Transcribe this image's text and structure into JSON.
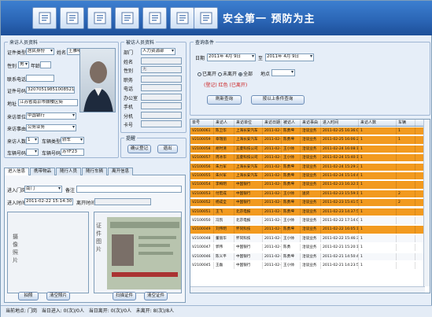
{
  "app_title": "安全第一  预防为主",
  "toolbar_icons": [
    "document-edit-icon",
    "id-card-icon",
    "person-card-icon",
    "form-edit-icon",
    "refresh-icon",
    "print-icon",
    "exit-icon"
  ],
  "colors": {
    "header": "#2a64b4",
    "highlight_row": "#f29a1f"
  },
  "visitor_panel": {
    "legend": "来访人员资料",
    "id_type_label": "证件类型",
    "id_type": "居民身份",
    "name_label": "姓名",
    "name": "王雅明",
    "gender_label": "性别",
    "gender": "男",
    "age_label": "年龄",
    "phone_label": "联系电话",
    "id_no_label": "证件号码",
    "id_no": "320705198510085215",
    "address_label": "地址",
    "address": "江苏省南京市鼓楼区街",
    "unit_label": "来访单位",
    "unit": "中国银行",
    "reason_label": "来访事由",
    "reason": "公务业务",
    "count_label": "来访人数",
    "count": "1",
    "car_type_label": "车辆类型",
    "car_type": "轿车",
    "plate_label": "车辆号码",
    "plate": "苏YF23"
  },
  "host_panel": {
    "legend": "被访人员资料",
    "dept_label": "部门",
    "dept": "人力资源部",
    "name_label": "姓名",
    "gender_label": "性别",
    "duty_label": "职务",
    "phone_label": "电话",
    "office_label": "办公室",
    "mobile_label": "手机",
    "ext_label": "分机",
    "card_label": "卡号",
    "field_values": [
      "",
      "无",
      "",
      "",
      "",
      "",
      "",
      ""
    ]
  },
  "search_panel": {
    "legend": "提醒",
    "btn_confirm": "确认登记",
    "btn_exit": "退出"
  },
  "tabs": [
    "进入信息",
    "携带物品",
    "随行人员",
    "随行车辆",
    "离开信息"
  ],
  "entry": {
    "gate_label": "进入门岗",
    "gate": "南门",
    "remark_label": "备注",
    "time_label": "进入时间",
    "time": "2011-02-22 15:14:30",
    "leave_label": "离开时间",
    "photo_label": "摄像照片",
    "id_photo_label": "证件图片",
    "btn1": "拍照",
    "btn2": "清空照片",
    "btn3": "扫描证件",
    "btn4": "清空证件"
  },
  "query": {
    "legend": "查询条件",
    "date_label": "日期",
    "date_from": "2011年 4月 9日",
    "to_label": "至",
    "date_to": "2011年 4月 9日",
    "status_options": [
      "已离开",
      "未离开",
      "全部"
    ],
    "location_label": "地点",
    "note": "(登记)  红色  (已离开)",
    "btn_query": "刷新查询",
    "btn_query2": "按以上条件查询"
  },
  "grid": {
    "columns": [
      "单号",
      "来访人",
      "来访单位",
      "来访日期",
      "被访人",
      "来访事由",
      "进入时间",
      "来访人数",
      "车辆"
    ],
    "rows": [
      [
        "V2100061",
        "陈卫华",
        "上海长安汽车",
        "2011-02-25",
        "陈勇坤",
        "洽谈业务",
        "2011-02-25 16:36:04",
        "1",
        "1"
      ],
      [
        "V2100059",
        "章瑞丽",
        "上海长安汽车",
        "2011-02-25",
        "陈勇坤",
        "洽谈业务",
        "2011-02-25 16:06:20",
        "1",
        "1"
      ],
      [
        "V2100058",
        "胡时清",
        "五菱科技公司",
        "2011-02-24",
        "王小帅",
        "洽谈业务",
        "2011-02-24 16:08:13",
        "1",
        ""
      ],
      [
        "V2100057",
        "周冰华",
        "五菱科技公司",
        "2011-02-24",
        "王小帅",
        "洽谈业务",
        "2011-02-24 15:40:11",
        "1",
        ""
      ],
      [
        "V2100056",
        "朱力军",
        "上海长安汽车",
        "2011-02-24",
        "陈勇坤",
        "洽谈业务",
        "2011-02-24 15:29:33",
        "1",
        ""
      ],
      [
        "V2100055",
        "朱兴军",
        "上海长安汽车",
        "2011-02-24",
        "陈勇坤",
        "洽谈业务",
        "2011-02-24 15:14:47",
        "1",
        ""
      ],
      [
        "V2100054",
        "李梅明",
        "中国银行",
        "2011-02-23",
        "陈勇坤",
        "洽谈业务",
        "2011-02-23 16:32:14",
        "1",
        ""
      ],
      [
        "V2100053",
        "付宏成",
        "中国银行",
        "2011-02-23",
        "王小帅",
        "送货",
        "2011-02-23 15:59:11",
        "1",
        "2"
      ],
      [
        "V2100052",
        "杨成全",
        "中国银行",
        "2011-02-23",
        "陈勇坤",
        "洽谈业务",
        "2011-02-23 15:41:58",
        "1",
        "2"
      ],
      [
        "V2100051",
        "王飞",
        "北京电报",
        "2011-02-23",
        "陈勇坤",
        "洽谈业务",
        "2011-02-23 14:37:51",
        "1",
        ""
      ],
      [
        "V2100050",
        "冯凯",
        "北京电报",
        "2011-02-22",
        "王小帅",
        "洽谈业务",
        "2011-02-22 17:14:02",
        "1",
        ""
      ],
      [
        "V2100049",
        "刘伟明",
        "怀同科技",
        "2011-02-22",
        "陈勇坤",
        "洽谈业务",
        "2011-02-22 16:05:19",
        "1",
        ""
      ],
      [
        "V2100048",
        "董丽华",
        "怀同科技",
        "2011-02-22",
        "王小帅",
        "洽谈业务",
        "2011-02-22 15:46:33",
        "1",
        ""
      ],
      [
        "V2100047",
        "郭伟",
        "中国银行",
        "2011-02-21",
        "陈勇",
        "洽谈业务",
        "2011-02-21 15:20:10",
        "1",
        ""
      ],
      [
        "V2100046",
        "陈义平",
        "中国银行",
        "2011-02-21",
        "陈勇坤",
        "洽谈业务",
        "2011-02-21 14:50:48",
        "1",
        ""
      ],
      [
        "V2100045",
        "王磊",
        "中国银行",
        "2011-02-21",
        "王小帅",
        "洽谈业务",
        "2011-02-21 14:23:55",
        "1",
        ""
      ]
    ],
    "highlight": [
      true,
      true,
      true,
      true,
      true,
      true,
      true,
      true,
      true,
      true,
      false,
      true,
      false,
      false,
      false,
      false
    ]
  },
  "status": {
    "location_label": "当前地点:",
    "location": "门岗",
    "today_in_label": "当日进入:",
    "today_in": "0(次)/0人",
    "today_out_label": "当日离开:",
    "today_out": "0(次)/0人",
    "not_left_label": "未离开:",
    "not_left": "8(次)/8人"
  }
}
